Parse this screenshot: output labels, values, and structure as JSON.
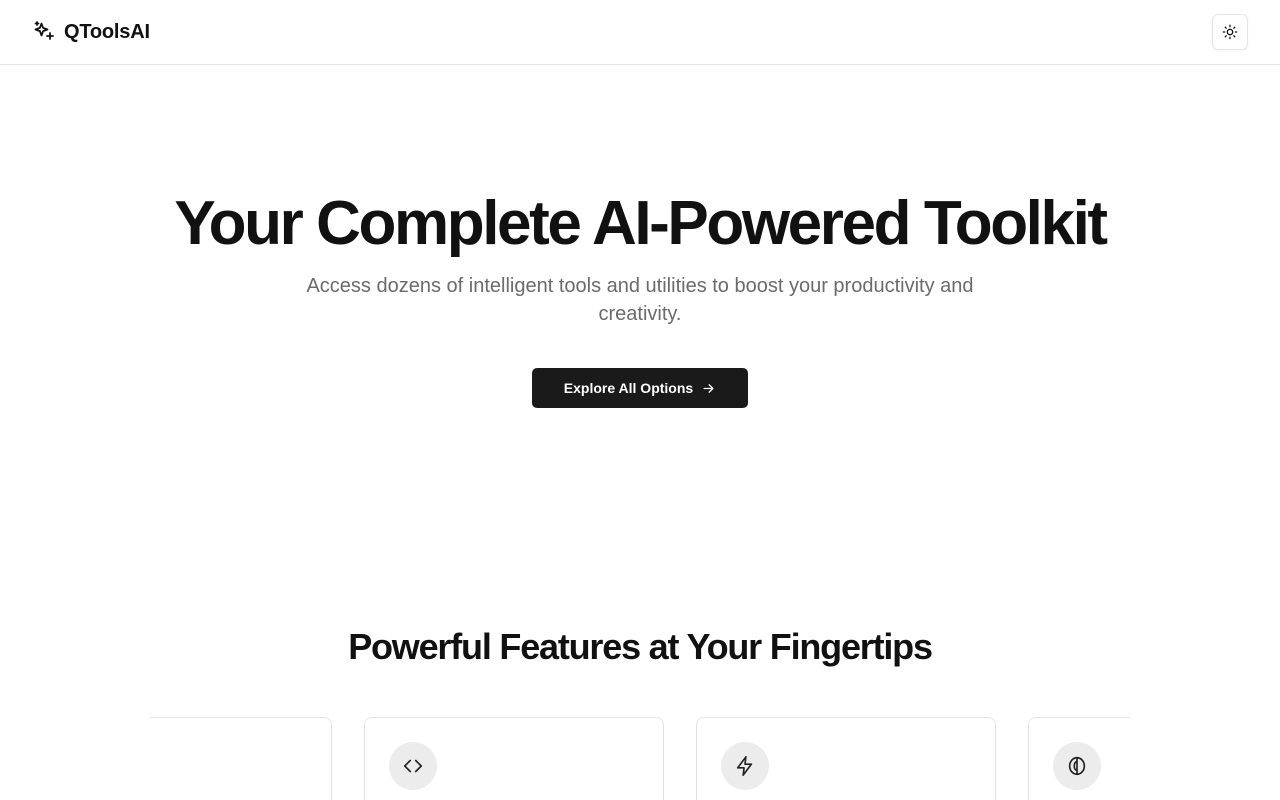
{
  "header": {
    "brand_icon": "sparkles-icon",
    "brand_name": "QToolsAI",
    "theme_toggle_icon": "sun-icon"
  },
  "hero": {
    "title": "Your Complete AI-Powered Toolkit",
    "subtitle": "Access dozens of intelligent tools and utilities to boost your productivity and creativity.",
    "cta_label": "Explore All Options",
    "cta_icon": "arrow-right-icon"
  },
  "features": {
    "title": "Powerful Features at Your Fingertips",
    "cards": [
      {
        "icon": "none"
      },
      {
        "icon": "code-icon"
      },
      {
        "icon": "zap-icon"
      },
      {
        "icon": "brain-icon"
      }
    ]
  },
  "colors": {
    "primary_button": "#1a1a1a",
    "text": "#111111",
    "muted_text": "#6b6b6b",
    "border": "#e5e5e5",
    "icon_circle": "#ececec"
  }
}
